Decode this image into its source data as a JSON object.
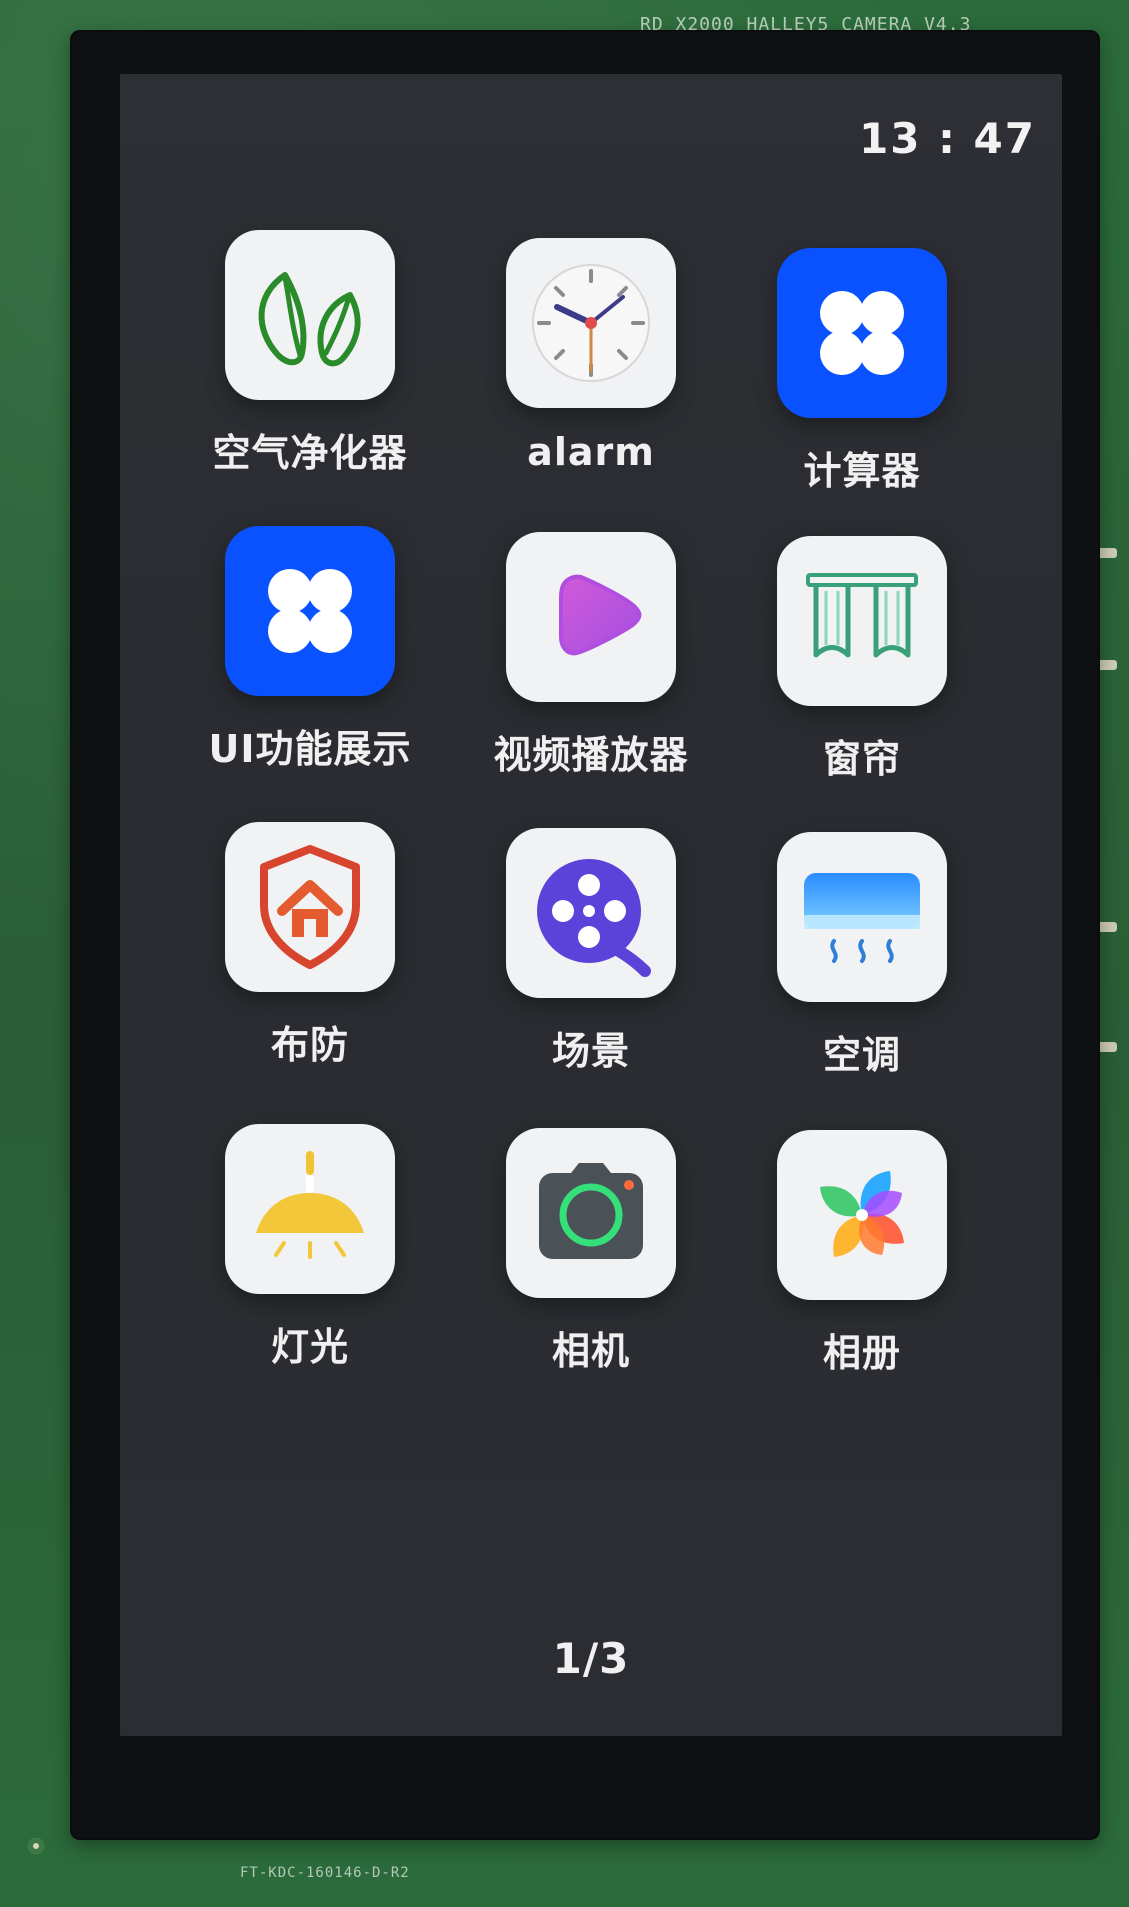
{
  "board": {
    "label_top": "RD_X2000_HALLEY5_CAMERA_V4.3",
    "label_bottom": "FT-KDC-160146-D-R2"
  },
  "status_bar": {
    "time": "13 : 47"
  },
  "apps": [
    {
      "label": "空气净化器",
      "icon": "leaf-icon",
      "icon_bg": "#f1f2f3"
    },
    {
      "label": "alarm",
      "icon": "clock-icon",
      "icon_bg": "#f1f2f3"
    },
    {
      "label": "计算器",
      "icon": "grid-icon",
      "icon_bg": "#0a52ff"
    },
    {
      "label": "UI功能展示",
      "icon": "grid-icon",
      "icon_bg": "#0a52ff"
    },
    {
      "label": "视频播放器",
      "icon": "play-icon",
      "icon_bg": "#f1f2f3"
    },
    {
      "label": "窗帘",
      "icon": "curtain-icon",
      "icon_bg": "#f1f2f3"
    },
    {
      "label": "布防",
      "icon": "shield-home-icon",
      "icon_bg": "#f1f2f3"
    },
    {
      "label": "场景",
      "icon": "film-reel-icon",
      "icon_bg": "#f1f2f3"
    },
    {
      "label": "空调",
      "icon": "air-conditioner-icon",
      "icon_bg": "#f1f2f3"
    },
    {
      "label": "灯光",
      "icon": "lamp-icon",
      "icon_bg": "#f1f2f3"
    },
    {
      "label": "相机",
      "icon": "camera-icon",
      "icon_bg": "#f1f2f3"
    },
    {
      "label": "相册",
      "icon": "pinwheel-photos-icon",
      "icon_bg": "#f1f2f3"
    }
  ],
  "page": {
    "indicator": "1/3"
  },
  "colors": {
    "screen_bg": "#2b2d32",
    "text": "#f0f0f0",
    "accent_blue": "#0a52ff"
  }
}
